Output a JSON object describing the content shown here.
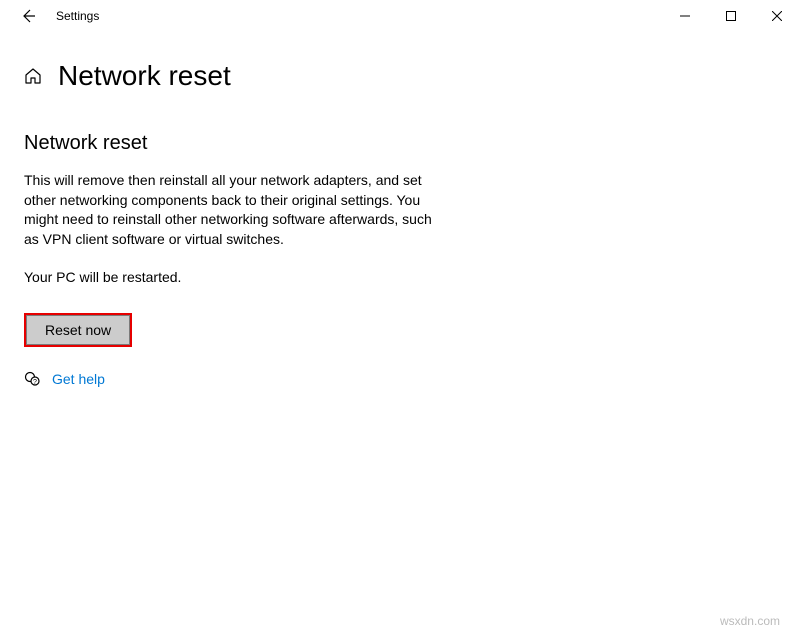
{
  "window": {
    "title": "Settings"
  },
  "header": {
    "title": "Network reset"
  },
  "main": {
    "section_title": "Network reset",
    "description": "This will remove then reinstall all your network adapters, and set other networking components back to their original settings. You might need to reinstall other networking software afterwards, such as VPN client software or virtual switches.",
    "restart_note": "Your PC will be restarted.",
    "reset_button": "Reset now",
    "help_link": "Get help"
  },
  "watermark": "wsxdn.com"
}
